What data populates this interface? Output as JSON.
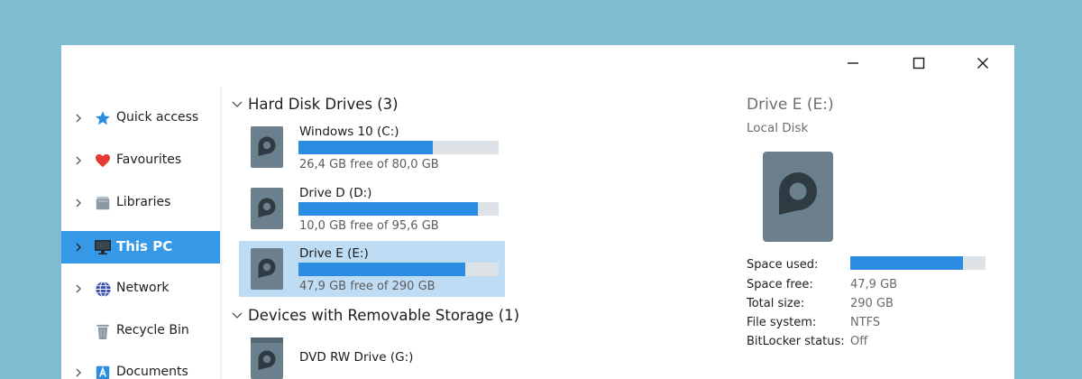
{
  "window": {
    "controls": {
      "minimize": "minimize-icon",
      "maximize": "maximize-icon",
      "close": "close-icon"
    }
  },
  "sidebar": {
    "items": [
      {
        "label": "Quick access",
        "icon": "star-icon",
        "color": "#2b8de2"
      },
      {
        "label": "Favourites",
        "icon": "heart-icon",
        "color": "#e53935"
      },
      {
        "label": "Libraries",
        "icon": "libraries-icon",
        "color": "#8a98a6"
      },
      {
        "label": "This PC",
        "icon": "monitor-icon",
        "selected": true
      },
      {
        "label": "Network",
        "icon": "globe-icon",
        "color": "#3a4fb0"
      },
      {
        "label": "Recycle Bin",
        "icon": "bin-icon",
        "color": "#8a98a6"
      },
      {
        "label": "Documents",
        "icon": "documents-icon",
        "color": "#2b8de2"
      }
    ],
    "selected_color": "#3599e8"
  },
  "content": {
    "groups": [
      {
        "label": "Hard Disk Drives (3)"
      },
      {
        "label": "Devices with Removable Storage (1)"
      }
    ],
    "drives": [
      {
        "name": "Windows 10 (C:)",
        "free_text": "26,4 GB free of 80,0 GB",
        "used_fraction": 0.67
      },
      {
        "name": "Drive D (D:)",
        "free_text": "10,0 GB free of 95,6 GB",
        "used_fraction": 0.895
      },
      {
        "name": "Drive E (E:)",
        "free_text": "47,9 GB free of 290 GB",
        "used_fraction": 0.835,
        "selected": true
      }
    ],
    "removable": [
      {
        "name": "DVD RW Drive (G:)"
      }
    ]
  },
  "details": {
    "title": "Drive E (E:)",
    "subtitle": "Local Disk",
    "used_fraction": 0.835,
    "properties": [
      {
        "label": "Space used:",
        "value": ""
      },
      {
        "label": "Space free:",
        "value": "47,9 GB"
      },
      {
        "label": "Total size:",
        "value": "290 GB"
      },
      {
        "label": "File system:",
        "value": "NTFS"
      },
      {
        "label": "BitLocker status:",
        "value": "Off"
      }
    ]
  },
  "colors": {
    "desktop": "#80bcd1",
    "accent": "#2b8de2",
    "selection": "#bfdcf5",
    "bar_track": "#dde2e7",
    "drive_icon": "#6c7f8c"
  }
}
